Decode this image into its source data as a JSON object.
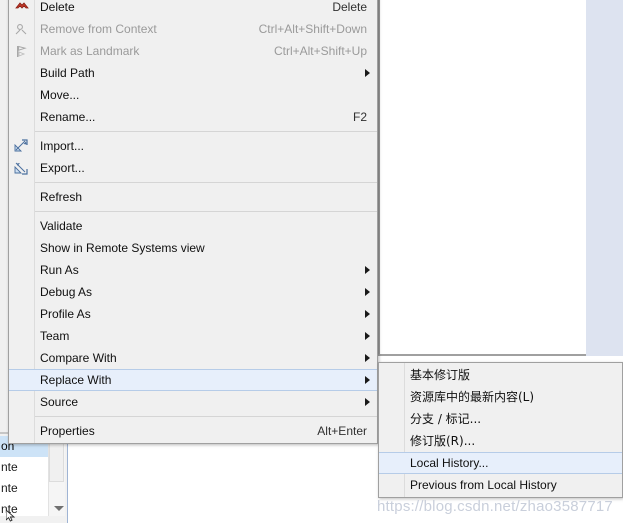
{
  "context_menu": {
    "items": [
      {
        "label": "Delete",
        "accel": "Delete",
        "arrow": false,
        "disabled": false,
        "icon": "delete-x-icon"
      },
      {
        "label": "Remove from Context",
        "accel": "Ctrl+Alt+Shift+Down",
        "arrow": false,
        "disabled": true,
        "icon": "remove-from-context-icon"
      },
      {
        "label": "Mark as Landmark",
        "accel": "Ctrl+Alt+Shift+Up",
        "arrow": false,
        "disabled": true,
        "icon": "landmark-icon"
      },
      {
        "label": "Build Path",
        "accel": "",
        "arrow": true,
        "disabled": false,
        "icon": ""
      },
      {
        "label": "Move...",
        "accel": "",
        "arrow": false,
        "disabled": false,
        "icon": ""
      },
      {
        "label": "Rename...",
        "accel": "F2",
        "arrow": false,
        "disabled": false,
        "icon": ""
      },
      {
        "separator": true
      },
      {
        "label": "Import...",
        "accel": "",
        "arrow": false,
        "disabled": false,
        "icon": "import-icon"
      },
      {
        "label": "Export...",
        "accel": "",
        "arrow": false,
        "disabled": false,
        "icon": "export-icon"
      },
      {
        "separator": true
      },
      {
        "label": "Refresh",
        "accel": "",
        "arrow": false,
        "disabled": false,
        "icon": ""
      },
      {
        "separator": true
      },
      {
        "label": "Validate",
        "accel": "",
        "arrow": false,
        "disabled": false,
        "icon": ""
      },
      {
        "label": "Show in Remote Systems view",
        "accel": "",
        "arrow": false,
        "disabled": false,
        "icon": ""
      },
      {
        "label": "Run As",
        "accel": "",
        "arrow": true,
        "disabled": false,
        "icon": ""
      },
      {
        "label": "Debug As",
        "accel": "",
        "arrow": true,
        "disabled": false,
        "icon": ""
      },
      {
        "label": "Profile As",
        "accel": "",
        "arrow": true,
        "disabled": false,
        "icon": ""
      },
      {
        "label": "Team",
        "accel": "",
        "arrow": true,
        "disabled": false,
        "icon": ""
      },
      {
        "label": "Compare With",
        "accel": "",
        "arrow": true,
        "disabled": false,
        "icon": ""
      },
      {
        "label": "Replace With",
        "accel": "",
        "arrow": true,
        "disabled": false,
        "highlighted": true,
        "icon": ""
      },
      {
        "label": "Source",
        "accel": "",
        "arrow": true,
        "disabled": false,
        "icon": ""
      },
      {
        "separator": true
      },
      {
        "label": "Properties",
        "accel": "Alt+Enter",
        "arrow": false,
        "disabled": false,
        "icon": ""
      }
    ]
  },
  "submenu": {
    "items": [
      {
        "label": "基本修订版",
        "highlighted": false
      },
      {
        "label": "资源库中的最新内容(L)",
        "highlighted": false
      },
      {
        "label": "分支 / 标记...",
        "highlighted": false
      },
      {
        "label": "修订版(R)...",
        "highlighted": false
      },
      {
        "label": "Local History...",
        "highlighted": true
      },
      {
        "label": "Previous from Local History",
        "highlighted": false
      }
    ]
  },
  "right_toolbar": {
    "icons": [
      {
        "name": "restore-window-icon",
        "glyph": "restore"
      },
      {
        "name": "console-view-icon",
        "glyph": "console"
      },
      {
        "name": "properties-view-icon",
        "glyph": "sliders"
      },
      {
        "name": "table-view-icon",
        "glyph": "table"
      },
      {
        "name": "servers-view-icon",
        "glyph": "server"
      },
      {
        "name": "data-source-explorer-icon",
        "glyph": "datasource"
      },
      {
        "name": "junit-view-icon",
        "glyph": "junit"
      },
      {
        "name": "annotations-view-icon",
        "glyph": "pen"
      },
      {
        "name": "tasks-view-icon",
        "glyph": "tasks"
      },
      {
        "name": "problems-view-icon",
        "glyph": "problems"
      }
    ]
  },
  "bottom_panel": {
    "tree_rows": [
      {
        "text": "on",
        "selected": true
      },
      {
        "text": "nte",
        "selected": false
      },
      {
        "text": "nte",
        "selected": false
      },
      {
        "text": "nte",
        "selected": false
      }
    ]
  },
  "watermark": {
    "text": "https://blog.csdn.net/zhao3587717"
  },
  "colors": {
    "menu_bg": "#f0f0f0",
    "highlight_bg": "#e7effb",
    "highlight_border": "#b6cce8",
    "disabled_text": "#9a9a9a",
    "toolbar_bg": "#e2e8f5",
    "watermark": "#c9cfdb"
  }
}
